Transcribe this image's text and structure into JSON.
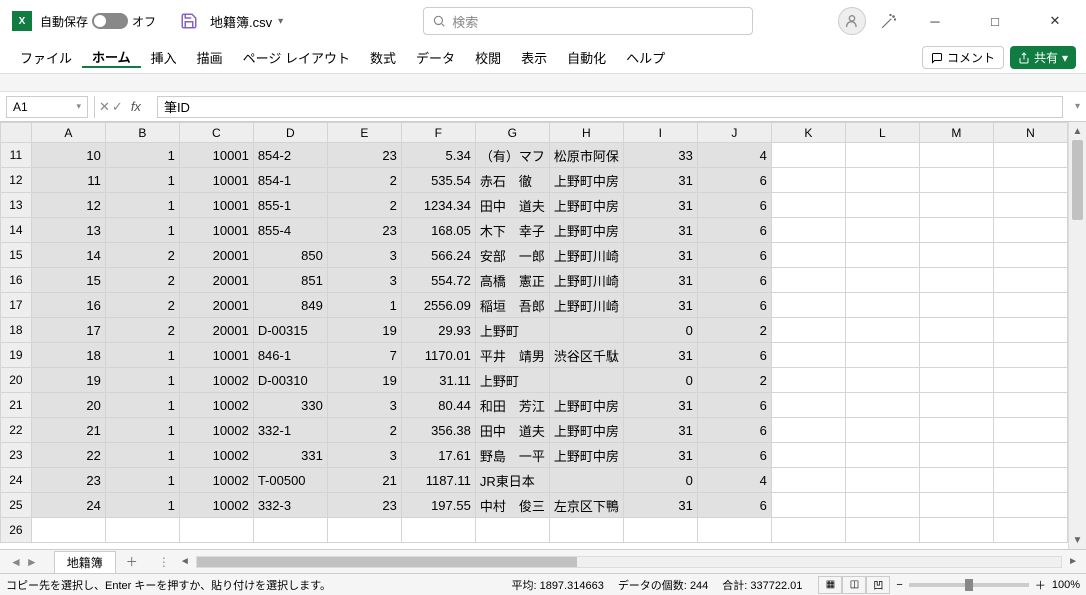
{
  "title": {
    "autosave_label": "自動保存",
    "autosave_state": "オフ",
    "filename": "地籍簿.csv",
    "search_placeholder": "検索"
  },
  "ribbon": {
    "tabs": [
      "ファイル",
      "ホーム",
      "挿入",
      "描画",
      "ページ レイアウト",
      "数式",
      "データ",
      "校閲",
      "表示",
      "自動化",
      "ヘルプ"
    ],
    "comment": "コメント",
    "share": "共有"
  },
  "formula": {
    "namebox": "A1",
    "value": "筆ID"
  },
  "columns": [
    "A",
    "B",
    "C",
    "D",
    "E",
    "F",
    "G",
    "H",
    "I",
    "J",
    "K",
    "L",
    "M",
    "N"
  ],
  "rows": [
    {
      "r": 11,
      "a": "10",
      "b": "1",
      "c": "10001",
      "d": "854-2",
      "e": "23",
      "f": "5.34",
      "g": "（有）マフ",
      "h": "松原市阿保",
      "i": "33",
      "j": "4"
    },
    {
      "r": 12,
      "a": "11",
      "b": "1",
      "c": "10001",
      "d": "854-1",
      "e": "2",
      "f": "535.54",
      "g": "赤石　徹",
      "h": "上野町中房",
      "i": "31",
      "j": "6"
    },
    {
      "r": 13,
      "a": "12",
      "b": "1",
      "c": "10001",
      "d": "855-1",
      "e": "2",
      "f": "1234.34",
      "g": "田中　道夫",
      "h": "上野町中房",
      "i": "31",
      "j": "6"
    },
    {
      "r": 14,
      "a": "13",
      "b": "1",
      "c": "10001",
      "d": "855-4",
      "e": "23",
      "f": "168.05",
      "g": "木下　幸子",
      "h": "上野町中房",
      "i": "31",
      "j": "6"
    },
    {
      "r": 15,
      "a": "14",
      "b": "2",
      "c": "20001",
      "d": "850",
      "e": "3",
      "f": "566.24",
      "g": "安部　一郎",
      "h": "上野町川崎",
      "i": "31",
      "j": "6"
    },
    {
      "r": 16,
      "a": "15",
      "b": "2",
      "c": "20001",
      "d": "851",
      "e": "3",
      "f": "554.72",
      "g": "高橋　憲正",
      "h": "上野町川崎",
      "i": "31",
      "j": "6"
    },
    {
      "r": 17,
      "a": "16",
      "b": "2",
      "c": "20001",
      "d": "849",
      "e": "1",
      "f": "2556.09",
      "g": "稲垣　吾郎",
      "h": "上野町川崎",
      "i": "31",
      "j": "6"
    },
    {
      "r": 18,
      "a": "17",
      "b": "2",
      "c": "20001",
      "d": "D-00315",
      "e": "19",
      "f": "29.93",
      "g": "上野町",
      "h": "",
      "i": "0",
      "j": "2"
    },
    {
      "r": 19,
      "a": "18",
      "b": "1",
      "c": "10001",
      "d": "846-1",
      "e": "7",
      "f": "1170.01",
      "g": "平井　靖男",
      "h": "渋谷区千駄",
      "i": "31",
      "j": "6"
    },
    {
      "r": 20,
      "a": "19",
      "b": "1",
      "c": "10002",
      "d": "D-00310",
      "e": "19",
      "f": "31.11",
      "g": "上野町",
      "h": "",
      "i": "0",
      "j": "2"
    },
    {
      "r": 21,
      "a": "20",
      "b": "1",
      "c": "10002",
      "d": "330",
      "e": "3",
      "f": "80.44",
      "g": "和田　芳江",
      "h": "上野町中房",
      "i": "31",
      "j": "6"
    },
    {
      "r": 22,
      "a": "21",
      "b": "1",
      "c": "10002",
      "d": "332-1",
      "e": "2",
      "f": "356.38",
      "g": "田中　道夫",
      "h": "上野町中房",
      "i": "31",
      "j": "6"
    },
    {
      "r": 23,
      "a": "22",
      "b": "1",
      "c": "10002",
      "d": "331",
      "e": "3",
      "f": "17.61",
      "g": "野島　一平",
      "h": "上野町中房",
      "i": "31",
      "j": "6"
    },
    {
      "r": 24,
      "a": "23",
      "b": "1",
      "c": "10002",
      "d": "T-00500",
      "e": "21",
      "f": "1187.11",
      "g": "JR東日本",
      "h": "",
      "i": "0",
      "j": "4"
    },
    {
      "r": 25,
      "a": "24",
      "b": "1",
      "c": "10002",
      "d": "332-3",
      "e": "23",
      "f": "197.55",
      "g": "中村　俊三",
      "h": "左京区下鴨",
      "i": "31",
      "j": "6"
    },
    {
      "r": 26,
      "a": "",
      "b": "",
      "c": "",
      "d": "",
      "e": "",
      "f": "",
      "g": "",
      "h": "",
      "i": "",
      "j": ""
    }
  ],
  "sheet_tab": "地籍簿",
  "status": {
    "message": "コピー先を選択し、Enter キーを押すか、貼り付けを選択します。",
    "avg_label": "平均:",
    "avg_value": "1897.314663",
    "count_label": "データの個数:",
    "count_value": "244",
    "sum_label": "合計:",
    "sum_value": "337722.01",
    "zoom": "100%"
  }
}
